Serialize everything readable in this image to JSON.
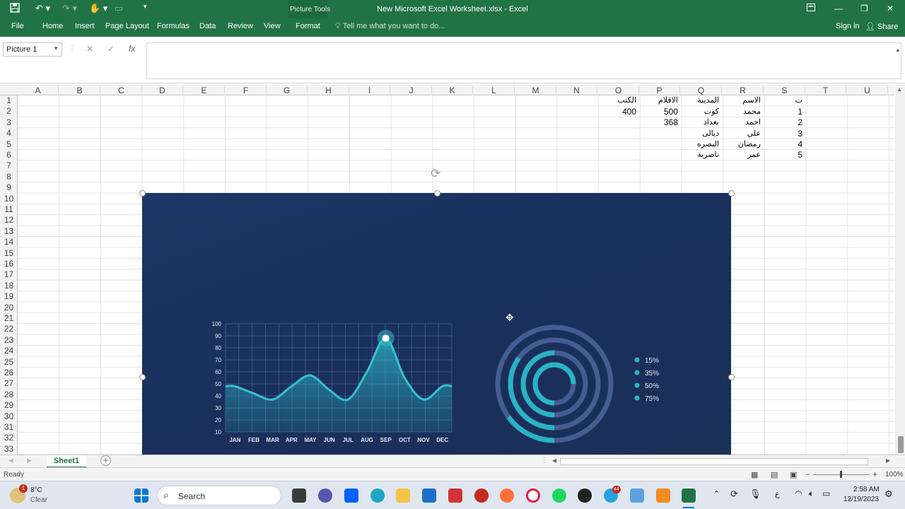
{
  "window": {
    "title": "New Microsoft Excel Worksheet.xlsx - Excel",
    "tool_tab": "Picture Tools",
    "accent": "#217346"
  },
  "ribbon": {
    "tabs": [
      "File",
      "Home",
      "Insert",
      "Page Layout",
      "Formulas",
      "Data",
      "Review",
      "View",
      "Format"
    ],
    "active_tab": "Format",
    "tellme": "Tell me what you want to do...",
    "signin": "Sign in",
    "share": "Share"
  },
  "formula_bar": {
    "name_box": "Picture 1",
    "fx": "fx",
    "cancel": "✕",
    "enter": "✓"
  },
  "columns": [
    "A",
    "B",
    "C",
    "D",
    "E",
    "F",
    "G",
    "H",
    "I",
    "J",
    "K",
    "L",
    "M",
    "N",
    "O",
    "P",
    "Q",
    "R",
    "S",
    "T",
    "U"
  ],
  "rows": [
    "1",
    "2",
    "3",
    "4",
    "5",
    "6",
    "7",
    "8",
    "9",
    "10",
    "11",
    "12",
    "13",
    "14",
    "15",
    "16",
    "17",
    "18",
    "19",
    "20",
    "21",
    "22",
    "23",
    "24",
    "25",
    "26",
    "27",
    "28",
    "29",
    "30",
    "31",
    "32",
    "33"
  ],
  "cells": {
    "O1": "الكتب",
    "P1": "الاقلام",
    "Q1": "المدينة",
    "R1": "الاسم",
    "S1": "ت",
    "O2": "400",
    "P2": "500",
    "Q2": "كوت",
    "R2": "محمد",
    "S2": "1",
    "P3": "368",
    "Q3": "بغداد",
    "R3": "احمد",
    "S3": "2",
    "Q4": "ديالى",
    "R4": "علي",
    "S4": "3",
    "Q5": "البصره",
    "R5": "رمضان",
    "S5": "4",
    "Q6": "ناصرية",
    "R6": "عمر",
    "S6": "5"
  },
  "chart_data": [
    {
      "type": "area",
      "categories": [
        "JAN",
        "FEB",
        "MAR",
        "APR",
        "MAY",
        "JUN",
        "JUL",
        "AUG",
        "SEP",
        "OCT",
        "NOV",
        "DEC"
      ],
      "values": [
        48,
        42,
        37,
        48,
        57,
        45,
        37,
        60,
        88,
        55,
        37,
        48
      ],
      "y_ticks": [
        "100",
        "90",
        "80",
        "70",
        "60",
        "50",
        "40",
        "30",
        "20",
        "10"
      ],
      "ylim": [
        10,
        100
      ],
      "grid": true,
      "color": "#2ab3c4"
    },
    {
      "type": "pie",
      "style": "concentric-rings",
      "labels": [
        "15%",
        "35%",
        "50%",
        "75%"
      ],
      "values": [
        15,
        35,
        50,
        75
      ],
      "legend": "right",
      "color": "#2ab3c4"
    }
  ],
  "sheets": [
    "Sheet1"
  ],
  "status": {
    "ready": "Ready",
    "zoom": "100%"
  },
  "taskbar": {
    "weather_temp": "8°C",
    "weather_desc": "Clear",
    "weather_badge": "1",
    "search": "Search",
    "time": "2:58 AM",
    "date": "12/19/2023",
    "lang": "ع",
    "telegram_badge": "44"
  }
}
